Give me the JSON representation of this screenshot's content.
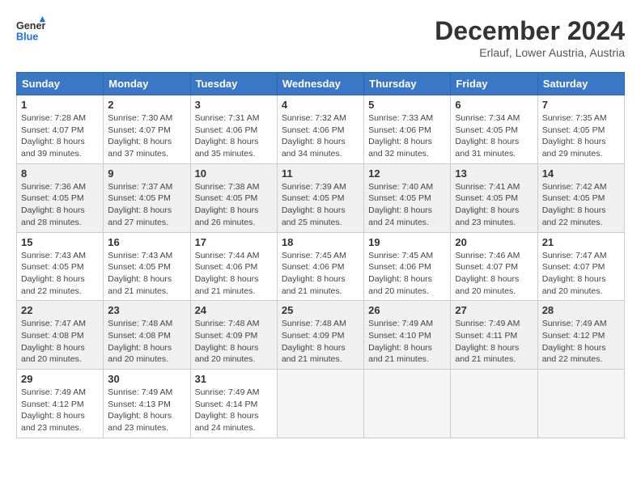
{
  "header": {
    "logo_line1": "General",
    "logo_line2": "Blue",
    "month": "December 2024",
    "location": "Erlauf, Lower Austria, Austria"
  },
  "weekdays": [
    "Sunday",
    "Monday",
    "Tuesday",
    "Wednesday",
    "Thursday",
    "Friday",
    "Saturday"
  ],
  "weeks": [
    [
      {
        "day": "1",
        "info": "Sunrise: 7:28 AM\nSunset: 4:07 PM\nDaylight: 8 hours and 39 minutes."
      },
      {
        "day": "2",
        "info": "Sunrise: 7:30 AM\nSunset: 4:07 PM\nDaylight: 8 hours and 37 minutes."
      },
      {
        "day": "3",
        "info": "Sunrise: 7:31 AM\nSunset: 4:06 PM\nDaylight: 8 hours and 35 minutes."
      },
      {
        "day": "4",
        "info": "Sunrise: 7:32 AM\nSunset: 4:06 PM\nDaylight: 8 hours and 34 minutes."
      },
      {
        "day": "5",
        "info": "Sunrise: 7:33 AM\nSunset: 4:06 PM\nDaylight: 8 hours and 32 minutes."
      },
      {
        "day": "6",
        "info": "Sunrise: 7:34 AM\nSunset: 4:05 PM\nDaylight: 8 hours and 31 minutes."
      },
      {
        "day": "7",
        "info": "Sunrise: 7:35 AM\nSunset: 4:05 PM\nDaylight: 8 hours and 29 minutes."
      }
    ],
    [
      {
        "day": "8",
        "info": "Sunrise: 7:36 AM\nSunset: 4:05 PM\nDaylight: 8 hours and 28 minutes."
      },
      {
        "day": "9",
        "info": "Sunrise: 7:37 AM\nSunset: 4:05 PM\nDaylight: 8 hours and 27 minutes."
      },
      {
        "day": "10",
        "info": "Sunrise: 7:38 AM\nSunset: 4:05 PM\nDaylight: 8 hours and 26 minutes."
      },
      {
        "day": "11",
        "info": "Sunrise: 7:39 AM\nSunset: 4:05 PM\nDaylight: 8 hours and 25 minutes."
      },
      {
        "day": "12",
        "info": "Sunrise: 7:40 AM\nSunset: 4:05 PM\nDaylight: 8 hours and 24 minutes."
      },
      {
        "day": "13",
        "info": "Sunrise: 7:41 AM\nSunset: 4:05 PM\nDaylight: 8 hours and 23 minutes."
      },
      {
        "day": "14",
        "info": "Sunrise: 7:42 AM\nSunset: 4:05 PM\nDaylight: 8 hours and 22 minutes."
      }
    ],
    [
      {
        "day": "15",
        "info": "Sunrise: 7:43 AM\nSunset: 4:05 PM\nDaylight: 8 hours and 22 minutes."
      },
      {
        "day": "16",
        "info": "Sunrise: 7:43 AM\nSunset: 4:05 PM\nDaylight: 8 hours and 21 minutes."
      },
      {
        "day": "17",
        "info": "Sunrise: 7:44 AM\nSunset: 4:06 PM\nDaylight: 8 hours and 21 minutes."
      },
      {
        "day": "18",
        "info": "Sunrise: 7:45 AM\nSunset: 4:06 PM\nDaylight: 8 hours and 21 minutes."
      },
      {
        "day": "19",
        "info": "Sunrise: 7:45 AM\nSunset: 4:06 PM\nDaylight: 8 hours and 20 minutes."
      },
      {
        "day": "20",
        "info": "Sunrise: 7:46 AM\nSunset: 4:07 PM\nDaylight: 8 hours and 20 minutes."
      },
      {
        "day": "21",
        "info": "Sunrise: 7:47 AM\nSunset: 4:07 PM\nDaylight: 8 hours and 20 minutes."
      }
    ],
    [
      {
        "day": "22",
        "info": "Sunrise: 7:47 AM\nSunset: 4:08 PM\nDaylight: 8 hours and 20 minutes."
      },
      {
        "day": "23",
        "info": "Sunrise: 7:48 AM\nSunset: 4:08 PM\nDaylight: 8 hours and 20 minutes."
      },
      {
        "day": "24",
        "info": "Sunrise: 7:48 AM\nSunset: 4:09 PM\nDaylight: 8 hours and 20 minutes."
      },
      {
        "day": "25",
        "info": "Sunrise: 7:48 AM\nSunset: 4:09 PM\nDaylight: 8 hours and 21 minutes."
      },
      {
        "day": "26",
        "info": "Sunrise: 7:49 AM\nSunset: 4:10 PM\nDaylight: 8 hours and 21 minutes."
      },
      {
        "day": "27",
        "info": "Sunrise: 7:49 AM\nSunset: 4:11 PM\nDaylight: 8 hours and 21 minutes."
      },
      {
        "day": "28",
        "info": "Sunrise: 7:49 AM\nSunset: 4:12 PM\nDaylight: 8 hours and 22 minutes."
      }
    ],
    [
      {
        "day": "29",
        "info": "Sunrise: 7:49 AM\nSunset: 4:12 PM\nDaylight: 8 hours and 23 minutes."
      },
      {
        "day": "30",
        "info": "Sunrise: 7:49 AM\nSunset: 4:13 PM\nDaylight: 8 hours and 23 minutes."
      },
      {
        "day": "31",
        "info": "Sunrise: 7:49 AM\nSunset: 4:14 PM\nDaylight: 8 hours and 24 minutes."
      },
      null,
      null,
      null,
      null
    ]
  ]
}
